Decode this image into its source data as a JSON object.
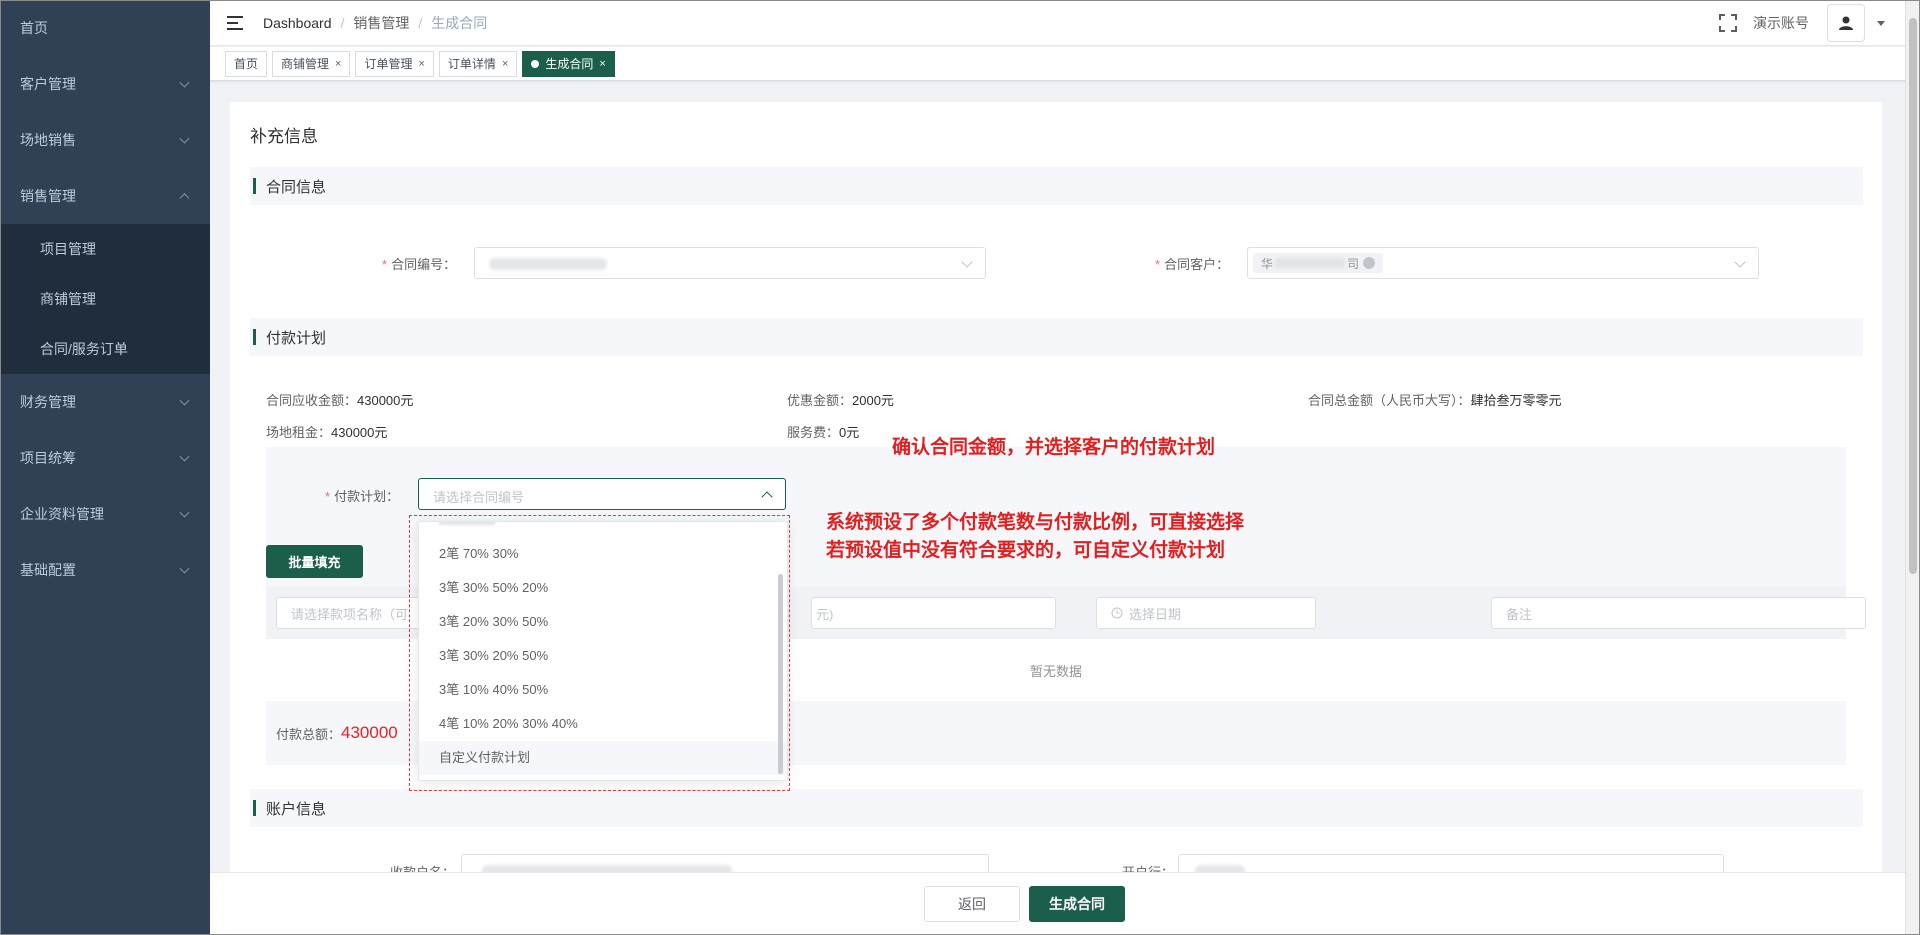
{
  "sidebar": {
    "items": [
      {
        "label": "首页"
      },
      {
        "label": "客户管理"
      },
      {
        "label": "场地销售"
      },
      {
        "label": "销售管理"
      },
      {
        "label": "财务管理"
      },
      {
        "label": "项目统筹"
      },
      {
        "label": "企业资料管理"
      },
      {
        "label": "基础配置"
      }
    ],
    "sub_items": [
      {
        "label": "项目管理"
      },
      {
        "label": "商铺管理"
      },
      {
        "label": "合同/服务订单"
      }
    ]
  },
  "breadcrumb": [
    "Dashboard",
    "销售管理",
    "生成合同"
  ],
  "navbar": {
    "account": "演示账号"
  },
  "tags": [
    {
      "label": "首页"
    },
    {
      "label": "商铺管理"
    },
    {
      "label": "订单管理"
    },
    {
      "label": "订单详情"
    },
    {
      "label": "生成合同"
    }
  ],
  "page_title": "补充信息",
  "sections": {
    "contract": "合同信息",
    "payment": "付款计划",
    "account": "账户信息"
  },
  "contract": {
    "number_label": "合同编号：",
    "customer_label": "合同客户：",
    "customer_chip": "华"
  },
  "payment": {
    "receivable_label": "合同应收金额：",
    "receivable_value": "430000元",
    "discount_label": "优惠金额：",
    "discount_value": "2000元",
    "total_cn_label": "合同总金额（人民币大写）：",
    "total_cn_value": "肆拾叁万零零元",
    "rent_label": "场地租金：",
    "rent_value": "430000元",
    "service_label": "服务费：",
    "service_value": "0元",
    "plan_label": "付款计划：",
    "plan_placeholder": "请选择合同编号",
    "batch_button": "批量填充",
    "row_name_placeholder": "请选择款项名称（可",
    "row_amount_placeholder": "元)",
    "row_date_placeholder": "选择日期",
    "row_note_placeholder": "备注",
    "empty_text": "暂无数据",
    "total_label": "付款总额：",
    "total_value": "430000"
  },
  "dropdown": {
    "options": [
      {
        "label": "2笔 70% 30%"
      },
      {
        "label": "3笔 30% 50% 20%"
      },
      {
        "label": "3笔 20% 30% 50%"
      },
      {
        "label": "3笔 30% 20% 50%"
      },
      {
        "label": "3笔 10% 40% 50%"
      },
      {
        "label": "4笔 10% 20% 30% 40%"
      },
      {
        "label": "自定义付款计划"
      }
    ]
  },
  "account_section": {
    "payee_label": "收款户名：",
    "bank_label": "开户行："
  },
  "annotations": {
    "a1": "确认合同金额，并选择客户的付款计划",
    "a2_line1": "系统预设了多个付款笔数与付款比例，可直接选择",
    "a2_line2": "若预设值中没有符合要求的，可自定义付款计划"
  },
  "footer": {
    "back": "返回",
    "generate": "生成合同"
  },
  "colors": {
    "brand": "#1b5e4b",
    "sidebar": "#304156",
    "annotation": "#e02020"
  }
}
